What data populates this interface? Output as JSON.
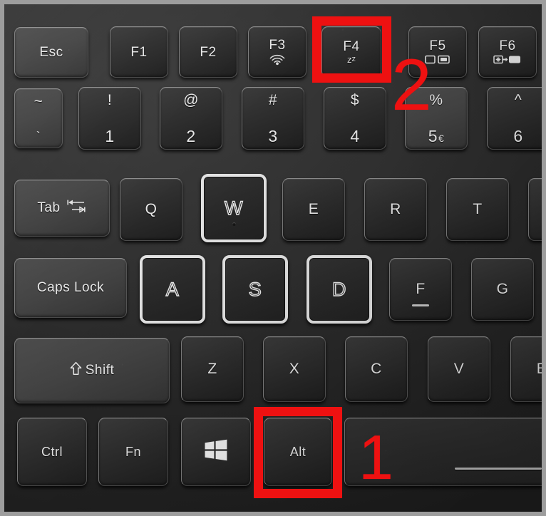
{
  "scene": {
    "title": "Laptop keyboard close-up with red annotations",
    "device": "laptop-keyboard",
    "frame_color": "#9d9d9d",
    "deck_color": "#2b2b2b",
    "key_color": "#2e2e2e",
    "legend_color": "#e8e8e8",
    "accent_color": "#ee1111",
    "highlight_rim_color": "#e3e3e3"
  },
  "annotations": [
    {
      "id": "callout-1",
      "label": "1",
      "target_key": "Alt",
      "box": true
    },
    {
      "id": "callout-2",
      "label": "2",
      "target_key": "F4",
      "box": true
    }
  ],
  "rows": [
    {
      "name": "function-row",
      "keys": [
        {
          "id": "esc",
          "label": "Esc",
          "style": "light"
        },
        {
          "id": "f1",
          "label": "F1",
          "sub": ""
        },
        {
          "id": "f2",
          "label": "F2",
          "sub": ""
        },
        {
          "id": "f3",
          "label": "F3",
          "sub": "wifi-icon",
          "sub_meaning": "wireless toggle"
        },
        {
          "id": "f4",
          "label": "F4",
          "sub": "zᴢ",
          "sub_meaning": "sleep",
          "highlighted_by": "callout-2"
        },
        {
          "id": "f5",
          "label": "F5",
          "sub": "display-switch-icon",
          "sub_meaning": "external display toggle"
        },
        {
          "id": "f6",
          "label": "F6",
          "sub": "touchpad-icon",
          "sub_meaning": "touchpad toggle"
        }
      ]
    },
    {
      "name": "number-row",
      "keys": [
        {
          "id": "tilde",
          "upper": "~",
          "lower": "`",
          "style": "light"
        },
        {
          "id": "1",
          "upper": "!",
          "lower": "1"
        },
        {
          "id": "2",
          "upper": "@",
          "lower": "2"
        },
        {
          "id": "3",
          "upper": "#",
          "lower": "3"
        },
        {
          "id": "4",
          "upper": "$",
          "lower": "4"
        },
        {
          "id": "5",
          "upper": "%",
          "lower": "5",
          "extra": "€"
        },
        {
          "id": "6",
          "upper": "^",
          "lower": "6"
        }
      ]
    },
    {
      "name": "qwerty-row",
      "keys": [
        {
          "id": "tab",
          "label": "Tab",
          "icon": "tab-arrows-icon",
          "style": "light"
        },
        {
          "id": "q",
          "label": "Q"
        },
        {
          "id": "w",
          "label": "W",
          "gaming_highlight": true
        },
        {
          "id": "e",
          "label": "E"
        },
        {
          "id": "r",
          "label": "R"
        },
        {
          "id": "t",
          "label": "T"
        },
        {
          "id": "y",
          "label": "",
          "partial": true
        }
      ]
    },
    {
      "name": "home-row",
      "keys": [
        {
          "id": "capslock",
          "label": "Caps Lock",
          "style": "light"
        },
        {
          "id": "a",
          "label": "A",
          "gaming_highlight": true
        },
        {
          "id": "s",
          "label": "S",
          "gaming_highlight": true
        },
        {
          "id": "d",
          "label": "D",
          "gaming_highlight": true
        },
        {
          "id": "f",
          "label": "F",
          "homing_bar": true
        },
        {
          "id": "g",
          "label": "G"
        },
        {
          "id": "h",
          "label": "",
          "partial": true
        }
      ]
    },
    {
      "name": "zxcv-row",
      "keys": [
        {
          "id": "lshift",
          "label": "Shift",
          "icon": "shift-arrow-icon",
          "style": "light"
        },
        {
          "id": "z",
          "label": "Z"
        },
        {
          "id": "x",
          "label": "X"
        },
        {
          "id": "c",
          "label": "C"
        },
        {
          "id": "v",
          "label": "V"
        },
        {
          "id": "b",
          "label": "B",
          "partial": true
        }
      ]
    },
    {
      "name": "bottom-row",
      "keys": [
        {
          "id": "ctrl",
          "label": "Ctrl"
        },
        {
          "id": "fn",
          "label": "Fn"
        },
        {
          "id": "win",
          "label": "",
          "icon": "windows-logo-icon"
        },
        {
          "id": "alt",
          "label": "Alt",
          "highlighted_by": "callout-1"
        },
        {
          "id": "space",
          "label": "",
          "is_spacebar": true
        }
      ]
    }
  ]
}
